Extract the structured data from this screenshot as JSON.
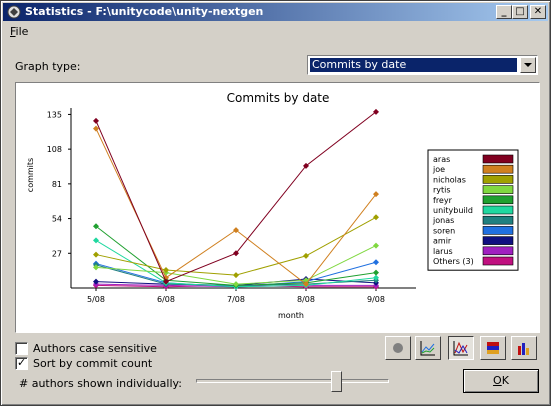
{
  "window": {
    "title": "Statistics - F:\\unitycode\\unity-nextgen",
    "minimize_glyph": "_",
    "maximize_glyph": "□",
    "close_glyph": "✕"
  },
  "menu": {
    "file_first": "F",
    "file_rest": "ile"
  },
  "graph_type": {
    "label": "Graph type:",
    "selected": "Commits by date"
  },
  "options": {
    "case_sensitive_label": "Authors case sensitive",
    "case_sensitive_checked": false,
    "sort_label": "Sort by commit count",
    "sort_checked": true,
    "authors_label": "# authors shown individually:",
    "slider_fraction": 0.74
  },
  "ok_button": {
    "first": "O",
    "rest": "K"
  },
  "toolbar_icons": [
    "circle-graph-icon",
    "line-graph-icon",
    "stacked-line-graph-icon",
    "stacked-bar-icon",
    "bar-graph-icon"
  ],
  "chart_data": {
    "type": "line",
    "title": "Commits by date",
    "xlabel": "month",
    "ylabel": "commits",
    "categories": [
      "5/08",
      "6/08",
      "7/08",
      "8/08",
      "9/08"
    ],
    "y_ticks": [
      27,
      54,
      81,
      108,
      135
    ],
    "ylim": [
      0,
      140
    ],
    "legend_position": "right",
    "series": [
      {
        "name": "aras",
        "color": "#800020",
        "values": [
          130,
          5,
          27,
          95,
          137
        ]
      },
      {
        "name": "joe",
        "color": "#d08020",
        "values": [
          124,
          8,
          45,
          3,
          73
        ]
      },
      {
        "name": "nicholas",
        "color": "#a0a000",
        "values": [
          26,
          14,
          10,
          25,
          55
        ]
      },
      {
        "name": "rytis",
        "color": "#80d840",
        "values": [
          16,
          12,
          3,
          6,
          33
        ]
      },
      {
        "name": "freyr",
        "color": "#20a030",
        "values": [
          48,
          6,
          2,
          4,
          12
        ]
      },
      {
        "name": "unitybuild",
        "color": "#20d8a0",
        "values": [
          37,
          4,
          1,
          2,
          8
        ]
      },
      {
        "name": "jonas",
        "color": "#208080",
        "values": [
          18,
          3,
          2,
          3,
          6
        ]
      },
      {
        "name": "soren",
        "color": "#2070e0",
        "values": [
          19,
          4,
          1,
          5,
          20
        ]
      },
      {
        "name": "amir",
        "color": "#101080",
        "values": [
          5,
          3,
          2,
          7,
          4
        ]
      },
      {
        "name": "larus",
        "color": "#a020c0",
        "values": [
          3,
          2,
          1,
          2,
          2
        ]
      },
      {
        "name": "Others (3)",
        "color": "#c01080",
        "values": [
          2,
          1,
          2,
          1,
          1
        ]
      }
    ]
  }
}
